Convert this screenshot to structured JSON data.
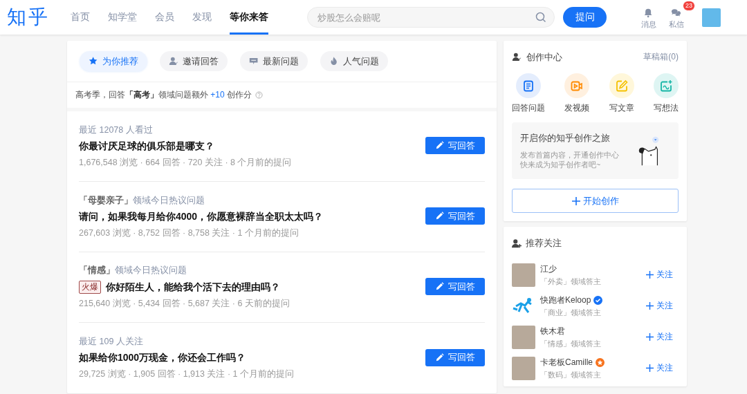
{
  "header": {
    "logo": "知乎",
    "nav": [
      {
        "label": "首页",
        "selected": false
      },
      {
        "label": "知学堂",
        "selected": false
      },
      {
        "label": "会员",
        "selected": false
      },
      {
        "label": "发现",
        "selected": false
      },
      {
        "label": "等你来答",
        "selected": true
      }
    ],
    "search": {
      "placeholder": "炒股怎么会赔呢"
    },
    "ask_button": "提问",
    "actions": [
      {
        "kind": "bell",
        "label": "消息"
      },
      {
        "kind": "chat",
        "label": "私信",
        "badge": "23"
      }
    ]
  },
  "filters": [
    {
      "kind": "star",
      "label": "为你推荐",
      "selected": true
    },
    {
      "kind": "person",
      "label": "邀请回答",
      "selected": false
    },
    {
      "kind": "new",
      "label": "最新问题",
      "selected": false
    },
    {
      "kind": "flame",
      "label": "人气问题",
      "selected": false
    }
  ],
  "notice": {
    "text": "高考季，回答**「高考」**领域问题额外",
    "bonus": "+10",
    "suffix": "创作分"
  },
  "questions": [
    {
      "context": "最近 12078 人看过",
      "title": "你最讨厌足球的俱乐部是哪支？",
      "meta": "1,676,548 浏览 · 664 回答 · 720 关注 · 8 个月前的提问",
      "button": "写回答"
    },
    {
      "context": "**「母婴亲子」**领域今日热议问题",
      "title": "请问，如果我每月给你4000，你愿意裸辞当全职太太吗？",
      "meta": "267,603 浏览 · 8,752 回答 · 8,758 关注 · 1 个月前的提问",
      "button": "写回答"
    },
    {
      "context": "**「情感」**领域今日热议问题",
      "tag": "火爆",
      "title": "你好陌生人，能给我个活下去的理由吗？",
      "meta": "215,640 浏览 · 5,434 回答 · 5,687 关注 · 6 天前的提问",
      "button": "写回答"
    },
    {
      "context": "最近 109 人关注",
      "title": "如果给你1000万现金，你还会工作吗？",
      "meta": "29,725 浏览 · 1,905 回答 · 1,913 关注 · 1 个月前的提问",
      "button": "写回答"
    }
  ],
  "creator": {
    "title": "创作中心",
    "drafts": "草稿箱(0)",
    "tools": [
      {
        "kind": "answer",
        "label": "回答问题"
      },
      {
        "kind": "video",
        "label": "发视频"
      },
      {
        "kind": "article",
        "label": "写文章"
      },
      {
        "kind": "idea",
        "label": "写想法"
      }
    ],
    "promo": {
      "title": "开启你的知乎创作之旅",
      "lines": [
        "发布首篇内容，开通创作中心",
        "快来成为知乎创作者吧~"
      ]
    },
    "start_button": "开始创作"
  },
  "follow": {
    "title": "推荐关注",
    "users": [
      {
        "kind": "photo",
        "name": "江少",
        "desc": "「外卖」领域答主",
        "button": "关注"
      },
      {
        "kind": "logo",
        "name": "快跑者Keloop",
        "verified": true,
        "desc": "「商业」领域答主",
        "button": "关注"
      },
      {
        "kind": "photo",
        "name": "铁木君",
        "desc": "「情感」领域答主",
        "button": "关注"
      },
      {
        "kind": "photo",
        "name": "卡老板Camille",
        "star_badge": true,
        "desc": "「数码」领域答主",
        "button": "关注"
      }
    ]
  }
}
